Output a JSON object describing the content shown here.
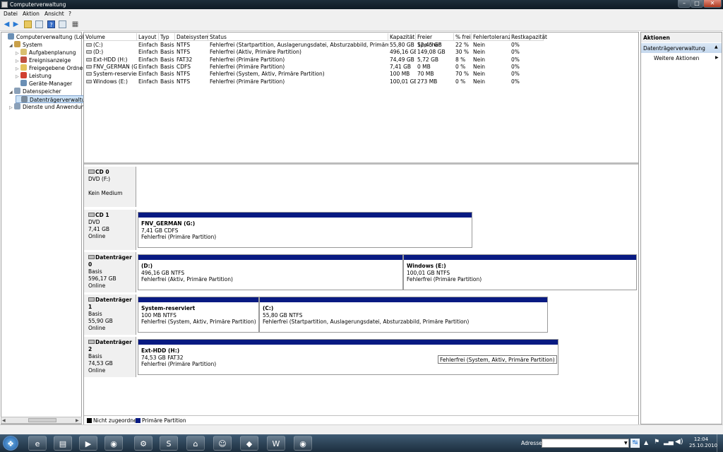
{
  "window": {
    "title": "Computerverwaltung"
  },
  "menubar": [
    "Datei",
    "Aktion",
    "Ansicht",
    "?"
  ],
  "tree": [
    {
      "label": "Computerverwaltung (Lokal)",
      "icon": "computer-icon",
      "indent": 0,
      "expander": ""
    },
    {
      "label": "System",
      "icon": "tools-icon",
      "indent": 1,
      "expander": "◢"
    },
    {
      "label": "Aufgabenplanung",
      "icon": "clock-icon",
      "indent": 2,
      "expander": "▷"
    },
    {
      "label": "Ereignisanzeige",
      "icon": "event-icon",
      "indent": 2,
      "expander": "▷"
    },
    {
      "label": "Freigegebene Ordner",
      "icon": "folder-icon",
      "indent": 2,
      "expander": "▷"
    },
    {
      "label": "Leistung",
      "icon": "performance-icon",
      "indent": 2,
      "expander": "▷"
    },
    {
      "label": "Geräte-Manager",
      "icon": "device-icon",
      "indent": 2,
      "expander": ""
    },
    {
      "label": "Datenspeicher",
      "icon": "storage-icon",
      "indent": 1,
      "expander": "◢"
    },
    {
      "label": "Datenträgerverwaltung",
      "icon": "disk-icon",
      "indent": 2,
      "expander": "",
      "selected": true
    },
    {
      "label": "Dienste und Anwendungen",
      "icon": "services-icon",
      "indent": 1,
      "expander": "▷"
    }
  ],
  "volumes": {
    "columns": [
      "Volume",
      "Layout",
      "Typ",
      "Dateisystem",
      "Status",
      "Kapazität",
      "Freier Speicher",
      "% frei",
      "Fehlertoleranz",
      "Restkapazität"
    ],
    "rows": [
      [
        "(C:)",
        "Einfach",
        "Basis",
        "NTFS",
        "Fehlerfrei (Startpartition, Auslagerungsdatei, Absturzabbild, Primäre Partition)",
        "55,80 GB",
        "12,45 GB",
        "22 %",
        "Nein",
        "0%"
      ],
      [
        "(D:)",
        "Einfach",
        "Basis",
        "NTFS",
        "Fehlerfrei (Aktiv, Primäre Partition)",
        "496,16 GB",
        "149,08 GB",
        "30 %",
        "Nein",
        "0%"
      ],
      [
        "Ext-HDD (H:)",
        "Einfach",
        "Basis",
        "FAT32",
        "Fehlerfrei (Primäre Partition)",
        "74,49 GB",
        "5,72 GB",
        "8 %",
        "Nein",
        "0%"
      ],
      [
        "FNV_GERMAN (G:)",
        "Einfach",
        "Basis",
        "CDFS",
        "Fehlerfrei (Primäre Partition)",
        "7,41 GB",
        "0 MB",
        "0 %",
        "Nein",
        "0%"
      ],
      [
        "System-reserviert",
        "Einfach",
        "Basis",
        "NTFS",
        "Fehlerfrei (System, Aktiv, Primäre Partition)",
        "100 MB",
        "70 MB",
        "70 %",
        "Nein",
        "0%"
      ],
      [
        "Windows (E:)",
        "Einfach",
        "Basis",
        "NTFS",
        "Fehlerfrei (Primäre Partition)",
        "100,01 GB",
        "273 MB",
        "0 %",
        "Nein",
        "0%"
      ]
    ]
  },
  "disks": [
    {
      "name": "CD 0",
      "type": "DVD (F:)",
      "size": "",
      "state": "Kein Medium",
      "partitions": []
    },
    {
      "name": "CD 1",
      "type": "DVD",
      "size": "7,41 GB",
      "state": "Online",
      "partitions": [
        {
          "title": "FNV_GERMAN  (G:)",
          "size": "7,41 GB CDFS",
          "status": "Fehlerfrei (Primäre Partition)"
        }
      ]
    },
    {
      "name": "Datenträger 0",
      "type": "Basis",
      "size": "596,17 GB",
      "state": "Online",
      "partitions": [
        {
          "title": "(D:)",
          "size": "496,16 GB NTFS",
          "status": "Fehlerfrei (Aktiv, Primäre Partition)"
        },
        {
          "title": "Windows  (E:)",
          "size": "100,01 GB NTFS",
          "status": "Fehlerfrei (Primäre Partition)"
        }
      ]
    },
    {
      "name": "Datenträger 1",
      "type": "Basis",
      "size": "55,90 GB",
      "state": "Online",
      "partitions": [
        {
          "title": "System-reserviert",
          "size": "100 MB NTFS",
          "status": "Fehlerfrei (System, Aktiv, Primäre Partition)"
        },
        {
          "title": "(C:)",
          "size": "55,80 GB NTFS",
          "status": "Fehlerfrei (Startpartition, Auslagerungsdatei, Absturzabbild, Primäre Partition)"
        }
      ]
    },
    {
      "name": "Datenträger 2",
      "type": "Basis",
      "size": "74,53 GB",
      "state": "Online",
      "partitions": [
        {
          "title": "Ext-HDD  (H:)",
          "size": "74,53 GB FAT32",
          "status": "Fehlerfrei (Primäre Partition)"
        }
      ]
    }
  ],
  "tooltip": "Fehlerfrei (System, Aktiv, Primäre Partition)",
  "legend": {
    "unallocated": "Nicht zugeordnet",
    "primary": "Primäre Partition",
    "unallocated_color": "#000000",
    "primary_color": "#081a82"
  },
  "actions": {
    "header": "Aktionen",
    "section": "Datenträgerverwaltung",
    "more": "Weitere Aktionen"
  },
  "taskbar": {
    "address_label": "Adresse",
    "time": "12:04",
    "date": "25.10.2010",
    "apps": [
      "start-orb-icon",
      "internet-explorer-icon",
      "explorer-icon",
      "media-player-icon",
      "firefox-icon",
      "installer-icon",
      "skype-icon",
      "network-icon",
      "messenger-icon",
      "game-icon",
      "word-icon",
      "firefox-icon"
    ]
  }
}
